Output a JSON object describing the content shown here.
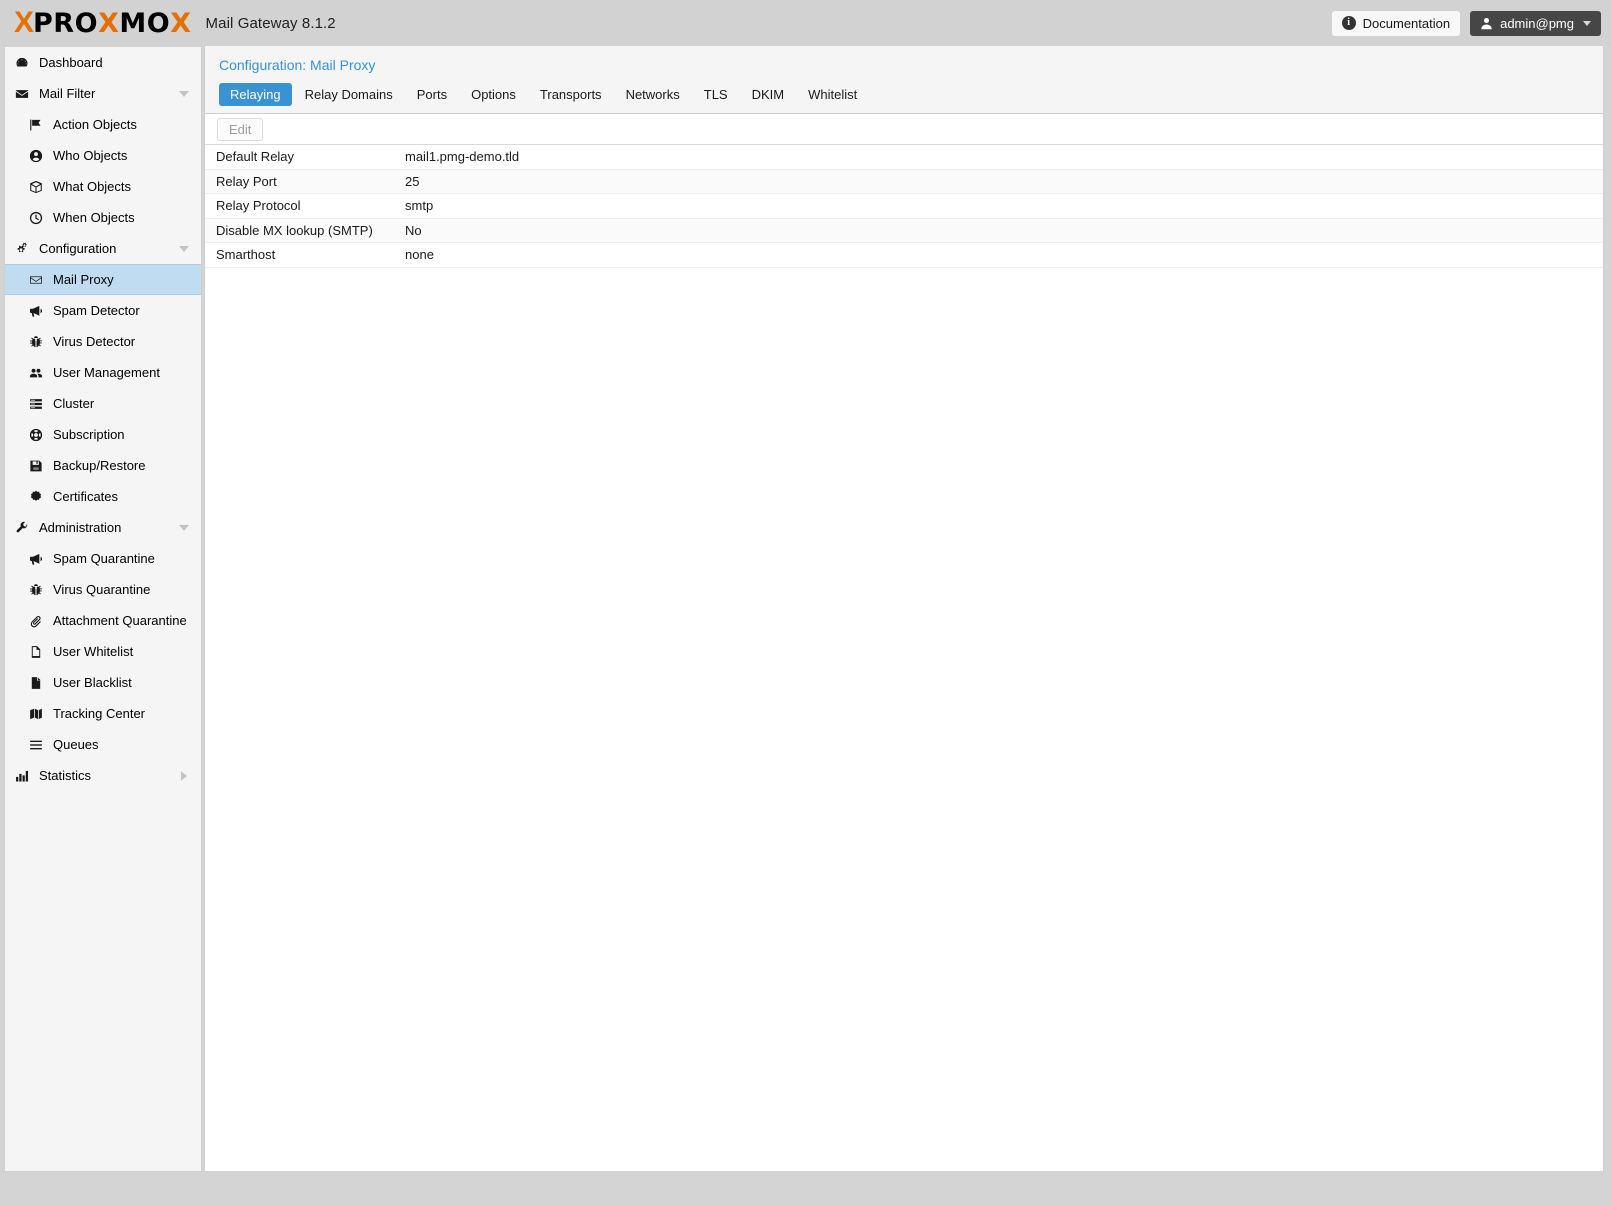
{
  "header": {
    "logo_x": "X",
    "logo_pro": "PRO",
    "logo_x2": "X",
    "logo_mo": "MO",
    "logo_x3": "X",
    "product": "Mail Gateway 8.1.2",
    "documentation_label": "Documentation",
    "user_label": "admin@pmg",
    "doc_icon": "info-icon",
    "user_icon": "user-icon",
    "caret_icon": "chevron-down-icon",
    "bg_color": "#d2d2d2",
    "accent_orange": "#e57000"
  },
  "sidebar": {
    "items": [
      {
        "label": "Dashboard",
        "icon": "dashboard-icon",
        "level": "root",
        "arrow": "none",
        "selected": false
      },
      {
        "label": "Mail Filter",
        "icon": "envelope-icon",
        "level": "root",
        "arrow": "down",
        "selected": false
      },
      {
        "label": "Action Objects",
        "icon": "flag-icon",
        "level": "child",
        "arrow": "none",
        "selected": false
      },
      {
        "label": "Who Objects",
        "icon": "user-circle-icon",
        "level": "child",
        "arrow": "none",
        "selected": false
      },
      {
        "label": "What Objects",
        "icon": "cube-icon",
        "level": "child",
        "arrow": "none",
        "selected": false
      },
      {
        "label": "When Objects",
        "icon": "clock-icon",
        "level": "child",
        "arrow": "none",
        "selected": false
      },
      {
        "label": "Configuration",
        "icon": "gears-icon",
        "level": "root",
        "arrow": "down",
        "selected": false
      },
      {
        "label": "Mail Proxy",
        "icon": "envelope-open-icon",
        "level": "child",
        "arrow": "none",
        "selected": true
      },
      {
        "label": "Spam Detector",
        "icon": "megaphone-icon",
        "level": "child",
        "arrow": "none",
        "selected": false
      },
      {
        "label": "Virus Detector",
        "icon": "bug-icon",
        "level": "child",
        "arrow": "none",
        "selected": false
      },
      {
        "label": "User Management",
        "icon": "users-icon",
        "level": "child",
        "arrow": "none",
        "selected": false
      },
      {
        "label": "Cluster",
        "icon": "server-icon",
        "level": "child",
        "arrow": "none",
        "selected": false
      },
      {
        "label": "Subscription",
        "icon": "lifebuoy-icon",
        "level": "child",
        "arrow": "none",
        "selected": false
      },
      {
        "label": "Backup/Restore",
        "icon": "save-icon",
        "level": "child",
        "arrow": "none",
        "selected": false
      },
      {
        "label": "Certificates",
        "icon": "certificate-icon",
        "level": "child",
        "arrow": "none",
        "selected": false
      },
      {
        "label": "Administration",
        "icon": "wrench-icon",
        "level": "root",
        "arrow": "down",
        "selected": false
      },
      {
        "label": "Spam Quarantine",
        "icon": "megaphone-icon",
        "level": "child",
        "arrow": "none",
        "selected": false
      },
      {
        "label": "Virus Quarantine",
        "icon": "bug-icon",
        "level": "child",
        "arrow": "none",
        "selected": false
      },
      {
        "label": "Attachment Quarantine",
        "icon": "paperclip-icon",
        "level": "child",
        "arrow": "none",
        "selected": false
      },
      {
        "label": "User Whitelist",
        "icon": "file-outline-icon",
        "level": "child",
        "arrow": "none",
        "selected": false
      },
      {
        "label": "User Blacklist",
        "icon": "file-filled-icon",
        "level": "child",
        "arrow": "none",
        "selected": false
      },
      {
        "label": "Tracking Center",
        "icon": "map-icon",
        "level": "child",
        "arrow": "none",
        "selected": false
      },
      {
        "label": "Queues",
        "icon": "list-icon",
        "level": "child",
        "arrow": "none",
        "selected": false
      },
      {
        "label": "Statistics",
        "icon": "bar-chart-icon",
        "level": "root",
        "arrow": "right",
        "selected": false
      }
    ],
    "selected_bg": "#bfdcf0"
  },
  "main": {
    "title": "Configuration: Mail Proxy",
    "title_color": "#3892d4",
    "active_tab_bg": "#3892d4",
    "tabs": [
      {
        "label": "Relaying",
        "active": true
      },
      {
        "label": "Relay Domains",
        "active": false
      },
      {
        "label": "Ports",
        "active": false
      },
      {
        "label": "Options",
        "active": false
      },
      {
        "label": "Transports",
        "active": false
      },
      {
        "label": "Networks",
        "active": false
      },
      {
        "label": "TLS",
        "active": false
      },
      {
        "label": "DKIM",
        "active": false
      },
      {
        "label": "Whitelist",
        "active": false
      }
    ],
    "toolbar": {
      "edit_label": "Edit",
      "edit_disabled": true
    },
    "rows": [
      {
        "key": "Default Relay",
        "value": "mail1.pmg-demo.tld"
      },
      {
        "key": "Relay Port",
        "value": "25"
      },
      {
        "key": "Relay Protocol",
        "value": "smtp"
      },
      {
        "key": "Disable MX lookup (SMTP)",
        "value": "No"
      },
      {
        "key": "Smarthost",
        "value": "none"
      }
    ]
  }
}
